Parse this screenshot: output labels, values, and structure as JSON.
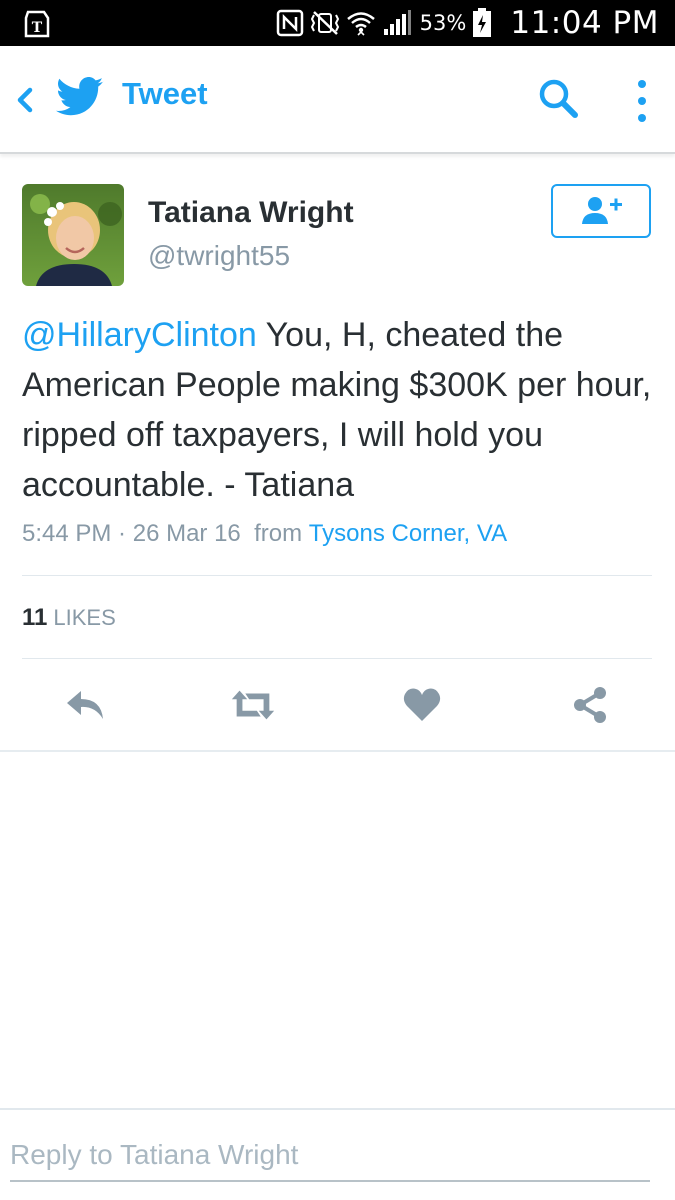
{
  "status_bar": {
    "battery_percent": "53%",
    "time": "11:04 PM"
  },
  "app_bar": {
    "title": "Tweet",
    "accent_color": "#1da1f2"
  },
  "tweet": {
    "display_name": "Tatiana Wright",
    "handle": "@twright55",
    "mention": "@HillaryClinton",
    "text": " You, H, cheated the American People making $300K per hour, ripped off taxpayers, I will hold you accountable. - Tatiana",
    "time": "5:44 PM",
    "dot": " · ",
    "date": "26 Mar 16",
    "from_label": "from",
    "location": "Tysons Corner, VA",
    "likes_count": "11",
    "likes_label": "LIKES"
  },
  "icons": {
    "back": "chevron-left-icon",
    "logo": "twitter-bird-icon",
    "search": "search-icon",
    "more": "more-vertical-icon",
    "follow": "add-user-icon",
    "reply": "reply-icon",
    "retweet": "retweet-icon",
    "like": "heart-icon",
    "share": "share-icon"
  },
  "reply_bar": {
    "placeholder": "Reply to Tatiana Wright"
  }
}
